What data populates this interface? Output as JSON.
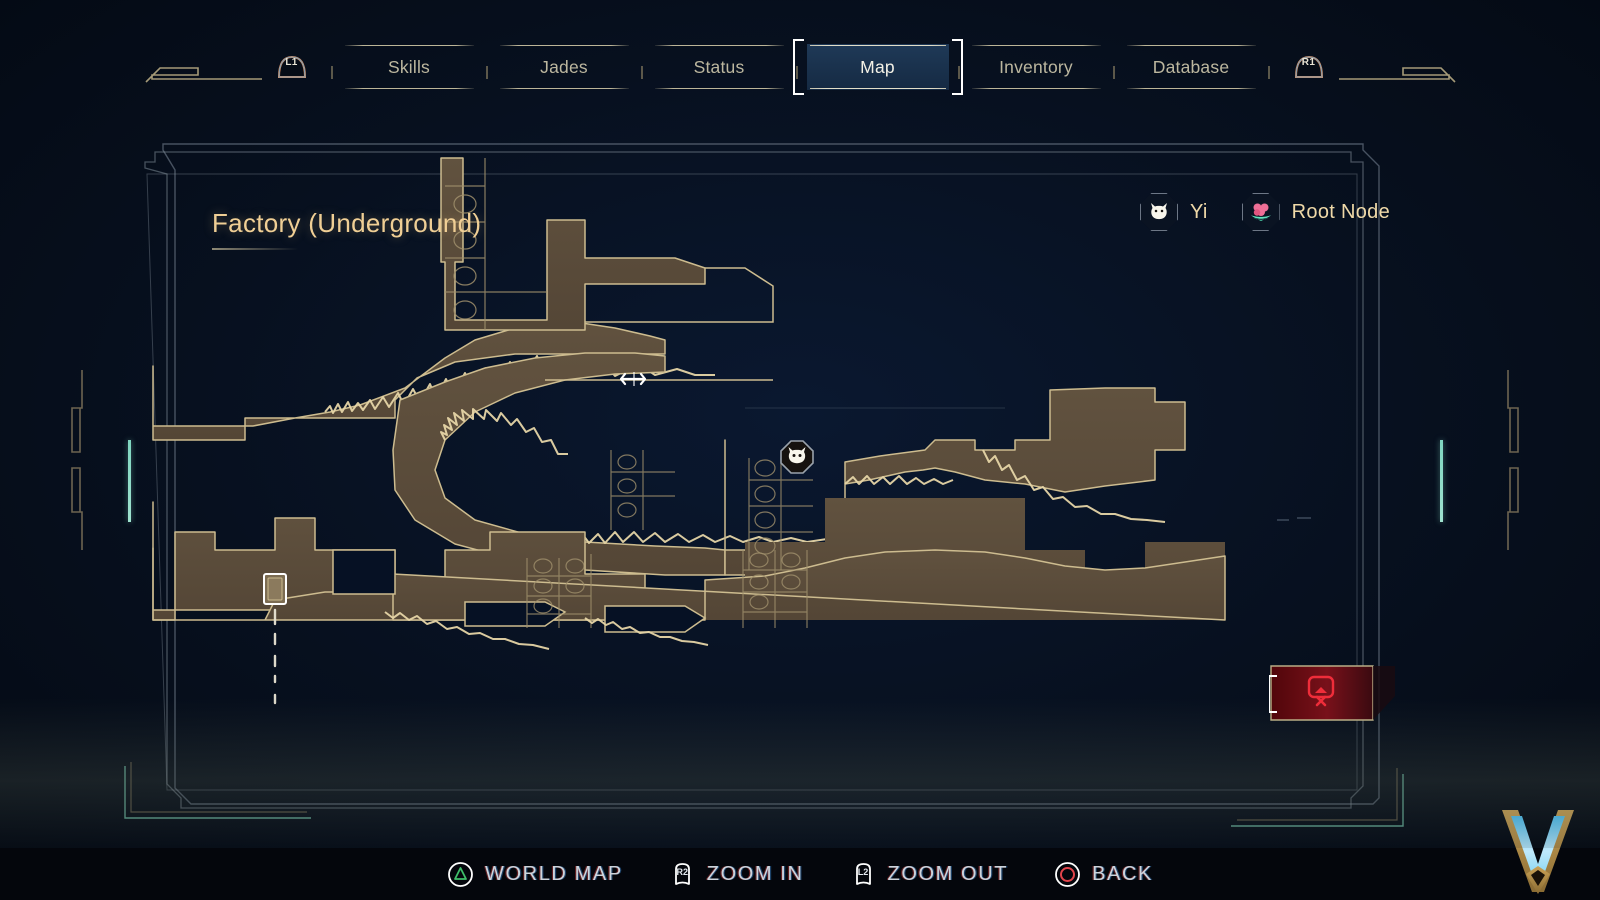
{
  "navbar": {
    "left_bumper": "L1",
    "right_bumper": "R1",
    "tabs": [
      {
        "label": "Skills",
        "active": false
      },
      {
        "label": "Jades",
        "active": false
      },
      {
        "label": "Status",
        "active": false
      },
      {
        "label": "Map",
        "active": true
      },
      {
        "label": "Inventory",
        "active": false
      },
      {
        "label": "Database",
        "active": false
      }
    ]
  },
  "map": {
    "title": "Factory (Underground)",
    "legend": [
      {
        "label": "Yi",
        "icon": "cat-head-icon",
        "color": "#f6f3e6"
      },
      {
        "label": "Root Node",
        "icon": "flower-icon",
        "color": "#ef6f97"
      }
    ],
    "player_marker": {
      "icon": "cat-head-icon",
      "label": "Yi"
    },
    "cursor": {
      "icon": "horizontal-resize-cursor"
    },
    "status_chip": {
      "icon": "screen-disconnected-icon",
      "color": "#e23a3a"
    }
  },
  "footer": {
    "hints": [
      {
        "button": "triangle",
        "label": "WORLD MAP",
        "color": "#3fbf6a"
      },
      {
        "button": "R2",
        "label": "ZOOM IN",
        "color": "#ffffff"
      },
      {
        "button": "L2",
        "label": "ZOOM OUT",
        "color": "#ffffff"
      },
      {
        "button": "circle",
        "label": "BACK",
        "color": "#e2444b"
      }
    ],
    "logo": "v-logo"
  },
  "theme": {
    "bg": "#061124",
    "terrain_fill": "#5b4c3c",
    "terrain_stroke": "#d8c79a",
    "accent_gold": "#f0cf95",
    "accent_tab": "#bcb79f",
    "active_tab_bg": "#213d5c",
    "teal": "#7fd6c0"
  }
}
